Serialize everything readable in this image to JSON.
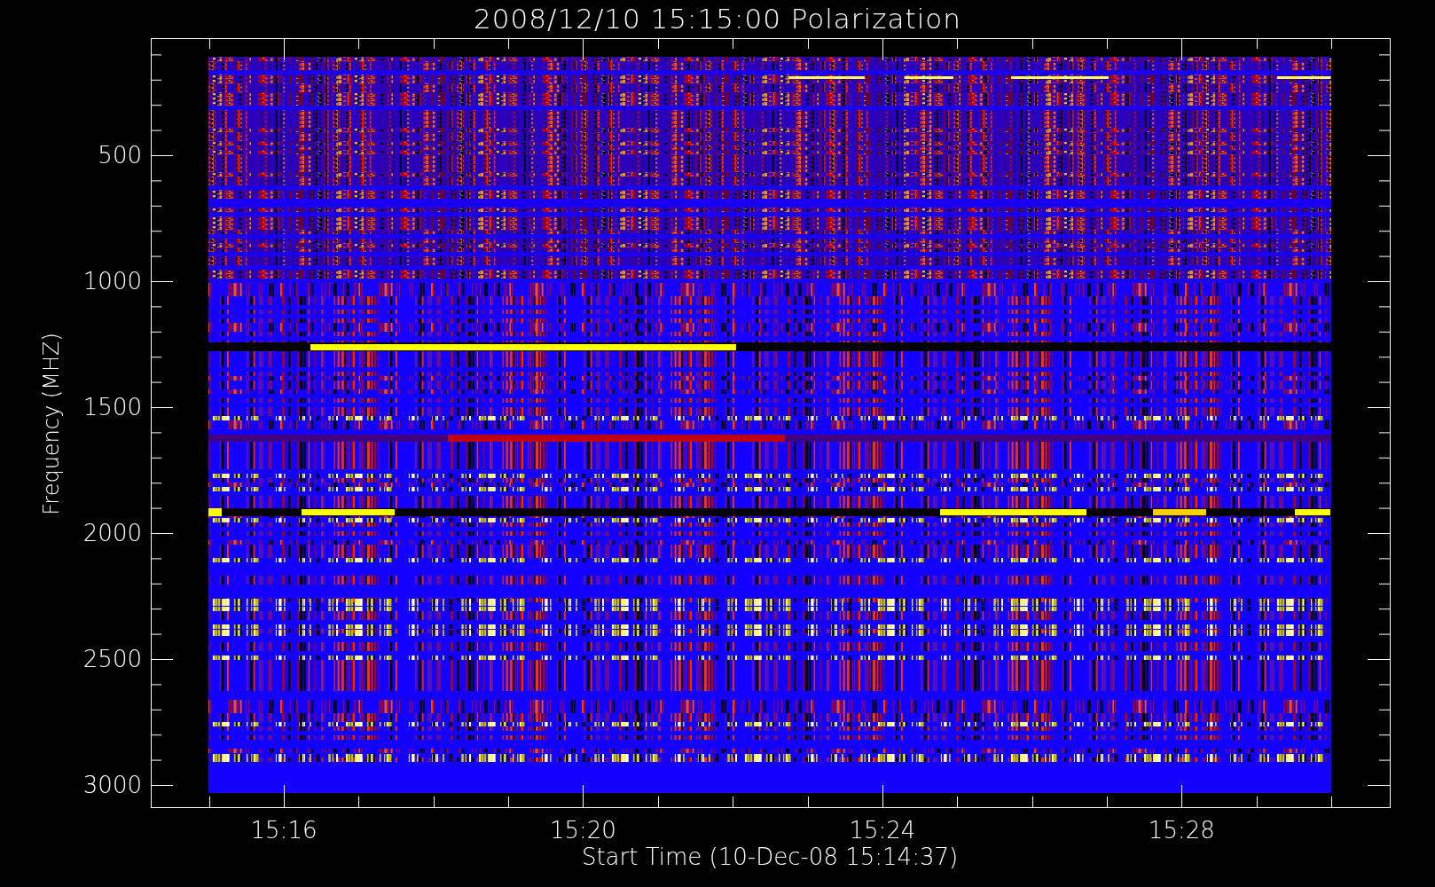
{
  "title": "2008/12/10 15:15:00 Polarization",
  "plot": {
    "ylabel": "Frequency (MHZ)",
    "xlabel": "Start Time (10-Dec-08 15:14:37)",
    "yticks": [
      "500",
      "1000",
      "1500",
      "2000",
      "2500",
      "3000"
    ],
    "xticks": [
      "15:16",
      "15:20",
      "15:24",
      "15:28"
    ]
  }
}
